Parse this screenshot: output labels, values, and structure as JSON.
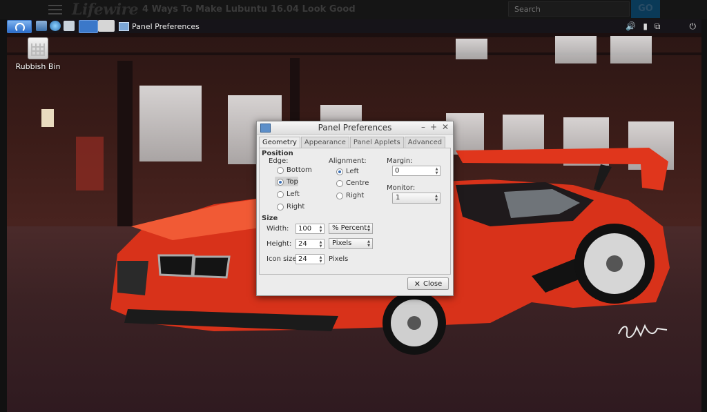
{
  "site": {
    "logo": "Lifewire",
    "article_title": "4 Ways To Make Lubuntu 16.04 Look Good",
    "search_placeholder": "Search",
    "go_label": "GO"
  },
  "taskbar": {
    "active_task": "Panel Preferences",
    "tray_icons": [
      "volume-icon",
      "battery-icon",
      "network-icon",
      "power-icon"
    ]
  },
  "desktop": {
    "icons": [
      {
        "label": "Rubbish Bin",
        "icon": "trash-icon"
      }
    ]
  },
  "dialog": {
    "title": "Panel Preferences",
    "tabs": [
      "Geometry",
      "Appearance",
      "Panel Applets",
      "Advanced"
    ],
    "active_tab": "Geometry",
    "position": {
      "heading": "Position",
      "edge_label": "Edge:",
      "edge_options": [
        "Bottom",
        "Top",
        "Left",
        "Right"
      ],
      "edge_selected": "Top",
      "alignment_label": "Alignment:",
      "alignment_options": [
        "Left",
        "Centre",
        "Right"
      ],
      "alignment_selected": "Left",
      "margin_label": "Margin:",
      "margin_value": "0",
      "monitor_label": "Monitor:",
      "monitor_value": "1"
    },
    "size": {
      "heading": "Size",
      "width_label": "Width:",
      "width_value": "100",
      "width_unit": "% Percent",
      "height_label": "Height:",
      "height_value": "24",
      "height_unit": "Pixels",
      "iconsize_label": "Icon size:",
      "iconsize_value": "24",
      "iconsize_unit": "Pixels"
    },
    "close_label": "Close"
  },
  "colors": {
    "accent": "#3b6fb5",
    "car_red": "#d8321a"
  }
}
